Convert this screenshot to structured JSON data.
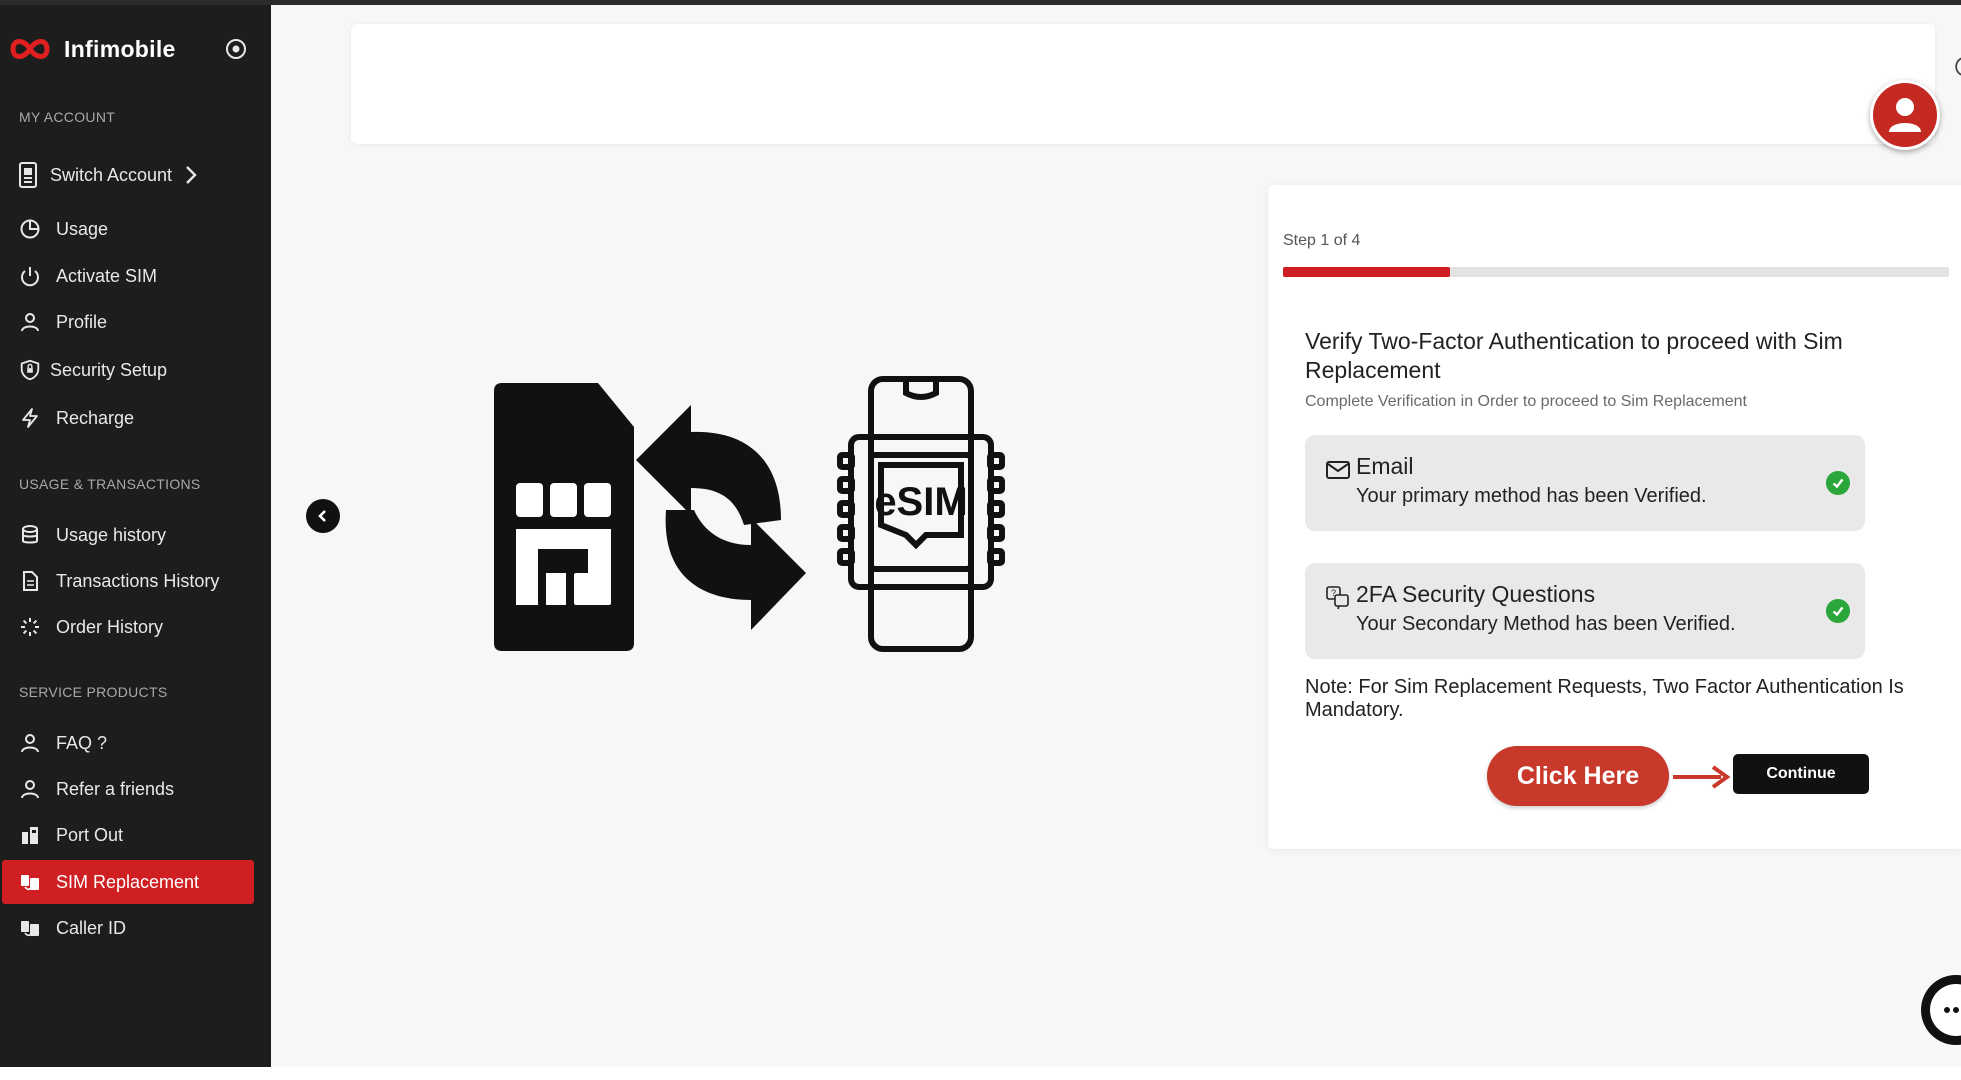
{
  "brand": {
    "name": "Infimobile",
    "accent": "#cf1f23"
  },
  "sidebar": {
    "sections": [
      {
        "label": "MY ACCOUNT"
      },
      {
        "label": "USAGE & TRANSACTIONS"
      },
      {
        "label": "SERVICE PRODUCTS"
      }
    ],
    "items": [
      {
        "label": "Switch Account",
        "icon": "phone-switch-icon"
      },
      {
        "label": "Usage",
        "icon": "pie-chart-icon"
      },
      {
        "label": "Activate SIM",
        "icon": "power-icon"
      },
      {
        "label": "Profile",
        "icon": "user-icon"
      },
      {
        "label": "Security Setup",
        "icon": "shield-lock-icon"
      },
      {
        "label": "Recharge",
        "icon": "bolt-icon"
      },
      {
        "label": "Usage history",
        "icon": "database-icon"
      },
      {
        "label": "Transactions History",
        "icon": "document-icon"
      },
      {
        "label": "Order History",
        "icon": "loader-icon"
      },
      {
        "label": "FAQ ?",
        "icon": "user-icon"
      },
      {
        "label": "Refer a friends",
        "icon": "user-icon"
      },
      {
        "label": "Port Out",
        "icon": "port-icon"
      },
      {
        "label": "SIM Replacement",
        "icon": "sim-icon",
        "active": true
      },
      {
        "label": "Caller ID",
        "icon": "sim-icon"
      }
    ]
  },
  "step": {
    "label": "Step 1 of 4",
    "progress": 0.25,
    "title": "Verify Two-Factor Authentication to proceed with Sim Replacement",
    "subtitle": "Complete Verification in Order to proceed to Sim Replacement",
    "methods": [
      {
        "title": "Email",
        "desc": "Your primary method has been Verified.",
        "icon": "mail-icon",
        "verified": true
      },
      {
        "title": "2FA Security Questions",
        "desc": "Your Secondary Method has been Verified.",
        "icon": "question-chat-icon",
        "verified": true
      }
    ],
    "note": "Note: For Sim Replacement Requests, Two Factor Authentication Is Mandatory.",
    "click_here": "Click Here",
    "continue": "Continue"
  },
  "hero": {
    "esim_label": "eSIM"
  },
  "colors": {
    "sidebar": "#1d1d1d",
    "check": "#2aa63a",
    "callout": "#c9392b"
  }
}
